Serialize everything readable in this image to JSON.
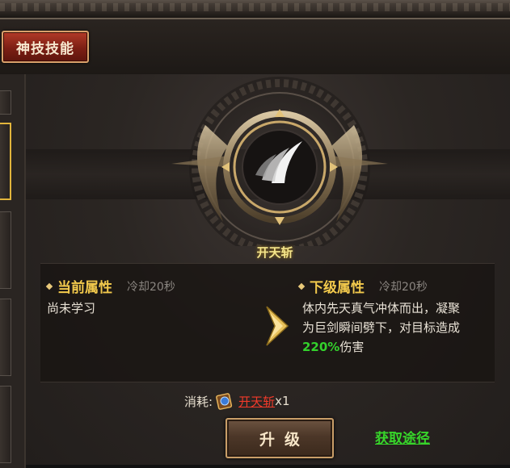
{
  "tab": {
    "label": "神技技能"
  },
  "skill": {
    "name": "开天斩"
  },
  "current": {
    "title": "当前属性",
    "cooldown": "冷却20秒",
    "desc": "尚未学习"
  },
  "next": {
    "title": "下级属性",
    "cooldown": "冷却20秒",
    "desc_line1": "体内先天真气冲体而出，凝聚",
    "desc_line2": "为巨剑瞬间劈下，对目标造成",
    "percent": "220%",
    "desc_tail": "伤害"
  },
  "cost": {
    "label": "消耗:",
    "item": "开天斩",
    "qty": "x1"
  },
  "buttons": {
    "upgrade": "升级",
    "source": "获取途径"
  },
  "colors": {
    "accent_gold": "#f2c94c",
    "link_green": "#37d52a",
    "cost_red": "#f23a2a",
    "tab_red": "#b23a28"
  },
  "icons": {
    "skill": "sword-slash-icon",
    "cost_item": "skill-book-icon",
    "arrow": "gold-arrow-icon"
  }
}
